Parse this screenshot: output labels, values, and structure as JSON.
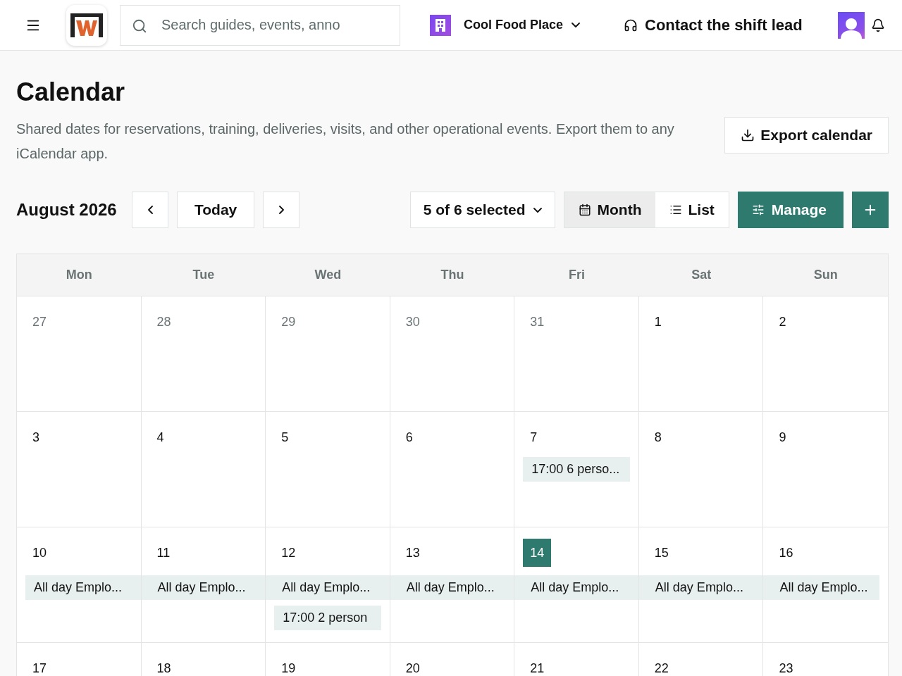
{
  "topbar": {
    "search": {
      "placeholder": "Search guides, events, anno"
    },
    "location": "Cool Food Place",
    "contact": "Contact the shift lead"
  },
  "page": {
    "title": "Calendar",
    "description": "Shared dates for reservations, training, deliveries, visits, and other operational events. Export them to any iCalendar app.",
    "export_button": "Export calendar"
  },
  "toolbar": {
    "month_label": "August 2026",
    "today_button": "Today",
    "filter": "5 of 6 selected",
    "views": [
      {
        "label": "Month",
        "selected": true
      },
      {
        "label": "List",
        "selected": false
      }
    ],
    "manage_button": "Manage"
  },
  "calendar": {
    "weekdays": [
      "Mon",
      "Tue",
      "Wed",
      "Thu",
      "Fri",
      "Sat",
      "Sun"
    ],
    "weeks": [
      [
        {
          "day": "27",
          "muted": true,
          "today": false
        },
        {
          "day": "28",
          "muted": true,
          "today": false
        },
        {
          "day": "29",
          "muted": true,
          "today": false
        },
        {
          "day": "30",
          "muted": true,
          "today": false
        },
        {
          "day": "31",
          "muted": true,
          "today": false
        },
        {
          "day": "1",
          "muted": false,
          "today": false
        },
        {
          "day": "2",
          "muted": false,
          "today": false
        }
      ],
      [
        {
          "day": "3",
          "muted": false,
          "today": false
        },
        {
          "day": "4",
          "muted": false,
          "today": false
        },
        {
          "day": "5",
          "muted": false,
          "today": false
        },
        {
          "day": "6",
          "muted": false,
          "today": false
        },
        {
          "day": "7",
          "muted": false,
          "today": false,
          "events": [
            {
              "kind": "timed",
              "text": "17:00 6 perso..."
            }
          ]
        },
        {
          "day": "8",
          "muted": false,
          "today": false
        },
        {
          "day": "9",
          "muted": false,
          "today": false
        }
      ],
      [
        {
          "day": "10",
          "muted": false,
          "today": false,
          "events": [
            {
              "kind": "allday",
              "text": "All day Emplo..."
            }
          ]
        },
        {
          "day": "11",
          "muted": false,
          "today": false,
          "events": [
            {
              "kind": "allday",
              "text": "All day Emplo..."
            }
          ]
        },
        {
          "day": "12",
          "muted": false,
          "today": false,
          "events": [
            {
              "kind": "allday",
              "text": "All day Emplo..."
            },
            {
              "kind": "timed",
              "text": "17:00 2 person"
            }
          ]
        },
        {
          "day": "13",
          "muted": false,
          "today": false,
          "events": [
            {
              "kind": "allday",
              "text": "All day Emplo..."
            }
          ]
        },
        {
          "day": "14",
          "muted": false,
          "today": true,
          "events": [
            {
              "kind": "allday",
              "text": "All day Emplo..."
            }
          ]
        },
        {
          "day": "15",
          "muted": false,
          "today": false,
          "events": [
            {
              "kind": "allday",
              "text": "All day Emplo..."
            }
          ]
        },
        {
          "day": "16",
          "muted": false,
          "today": false,
          "events": [
            {
              "kind": "allday",
              "text": "All day Emplo..."
            }
          ]
        }
      ],
      [
        {
          "day": "17",
          "muted": false,
          "today": false
        },
        {
          "day": "18",
          "muted": false,
          "today": false
        },
        {
          "day": "19",
          "muted": false,
          "today": false
        },
        {
          "day": "20",
          "muted": false,
          "today": false
        },
        {
          "day": "21",
          "muted": false,
          "today": false
        },
        {
          "day": "22",
          "muted": false,
          "today": false
        },
        {
          "day": "23",
          "muted": false,
          "today": false
        }
      ]
    ]
  }
}
